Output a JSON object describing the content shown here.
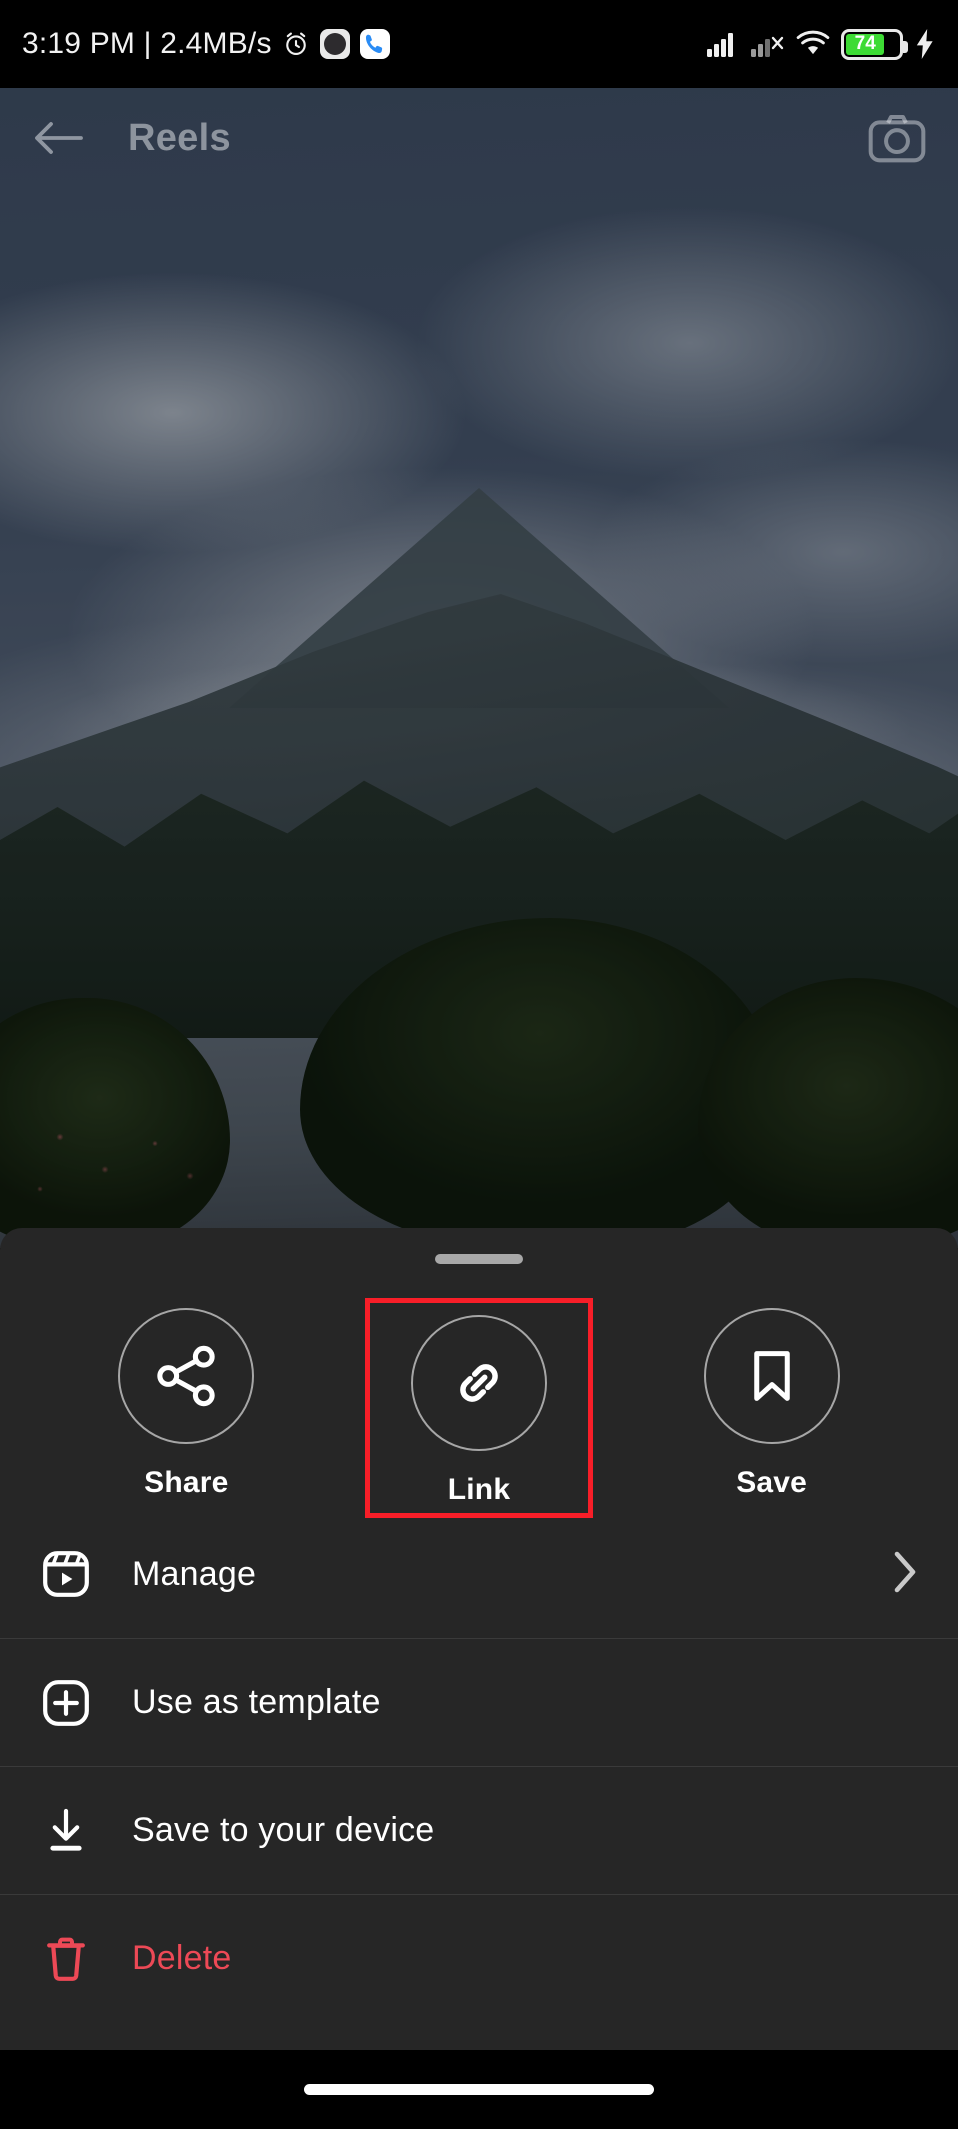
{
  "status_bar": {
    "time": "3:19 PM",
    "separator": "|",
    "network_speed": "2.4MB/s",
    "battery_percent": "74",
    "icons": [
      "alarm-icon",
      "clock-app-icon",
      "phone-app-icon",
      "signal-full-icon",
      "signal-no-service-icon",
      "wifi-icon",
      "battery-icon",
      "charging-bolt-icon"
    ]
  },
  "app_bar": {
    "title": "Reels",
    "back_icon": "back-arrow-icon",
    "camera_icon": "camera-icon"
  },
  "sheet": {
    "handle": "drag-handle",
    "actions": [
      {
        "label": "Share",
        "icon": "share-icon",
        "highlighted": false
      },
      {
        "label": "Link",
        "icon": "link-icon",
        "highlighted": true
      },
      {
        "label": "Save",
        "icon": "bookmark-icon",
        "highlighted": false
      }
    ],
    "menu": [
      {
        "label": "Manage",
        "icon": "reels-icon",
        "chevron": true,
        "danger": false
      },
      {
        "label": "Use as template",
        "icon": "plus-square-icon",
        "chevron": false,
        "danger": false
      },
      {
        "label": "Save to your device",
        "icon": "download-icon",
        "chevron": false,
        "danger": false
      },
      {
        "label": "Delete",
        "icon": "trash-icon",
        "chevron": false,
        "danger": true
      }
    ]
  },
  "colors": {
    "highlight": "#f71e28",
    "danger": "#ed4956",
    "sheet_bg": "#262626",
    "battery_green": "#3ddb34"
  },
  "nav_bar": {
    "home_indicator": "home-indicator"
  }
}
